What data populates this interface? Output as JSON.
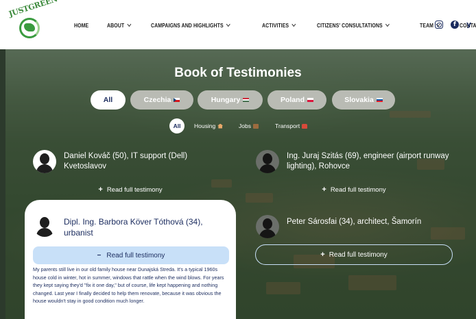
{
  "header": {
    "logo_text": "JUSTGREEN",
    "nav": [
      {
        "label": "HOME",
        "dropdown": false
      },
      {
        "label": "ABOUT",
        "dropdown": true
      },
      {
        "label": "CAMPAIGNS AND HIGHLIGHTS",
        "dropdown": true
      },
      {
        "label": "ACTIVITIES",
        "dropdown": true
      },
      {
        "label": "CITIZENS' CONSULTATIONS",
        "dropdown": true
      },
      {
        "label": "TEAM",
        "dropdown": true
      },
      {
        "label": "CONTACT",
        "dropdown": false
      }
    ],
    "social": [
      "instagram-icon",
      "facebook-icon",
      "twitter-icon"
    ]
  },
  "section": {
    "title": "Book of Testimonies",
    "country_filters": [
      {
        "label": "All",
        "active": true
      },
      {
        "label": "Czechia",
        "flag": "cz"
      },
      {
        "label": "Hungary",
        "flag": "hu"
      },
      {
        "label": "Poland",
        "flag": "pl"
      },
      {
        "label": "Slovakia",
        "flag": "sk"
      }
    ],
    "topic_filters": [
      {
        "label": "All",
        "active": true
      },
      {
        "label": "Housing"
      },
      {
        "label": "Jobs"
      },
      {
        "label": "Transport"
      }
    ],
    "read_label": "Read full testimony",
    "testimonies": [
      {
        "name": "Daniel Kováč (50), IT support (Dell) Kvetoslavov"
      },
      {
        "name": "Ing. Juraj Szitás (69), engineer (airport runway lighting), Rohovce"
      },
      {
        "name": "Dipl. Ing. Barbora Köver Tóthová (34), urbanist",
        "expanded": true,
        "text": "My parents still live in our old family house near Dunajská Streda. It's a typical 1960s house cold in winter, hot in summer, windows that rattle when the wind blows. For years they kept saying they'd \"fix it one day,\" but of course, life kept happening and nothing changed. Last year I finally decided to help them renovate, because it was obvious the house wouldn't stay in good condition much longer."
      },
      {
        "name": "Peter Sárosfai (34), architect, Šamorín"
      }
    ]
  },
  "colors": {
    "navy": "#1a2b5e",
    "pill_inactive": "#b9bbb4",
    "card_button": "#c8e0f8",
    "logo_green": "#3a9b3f"
  }
}
